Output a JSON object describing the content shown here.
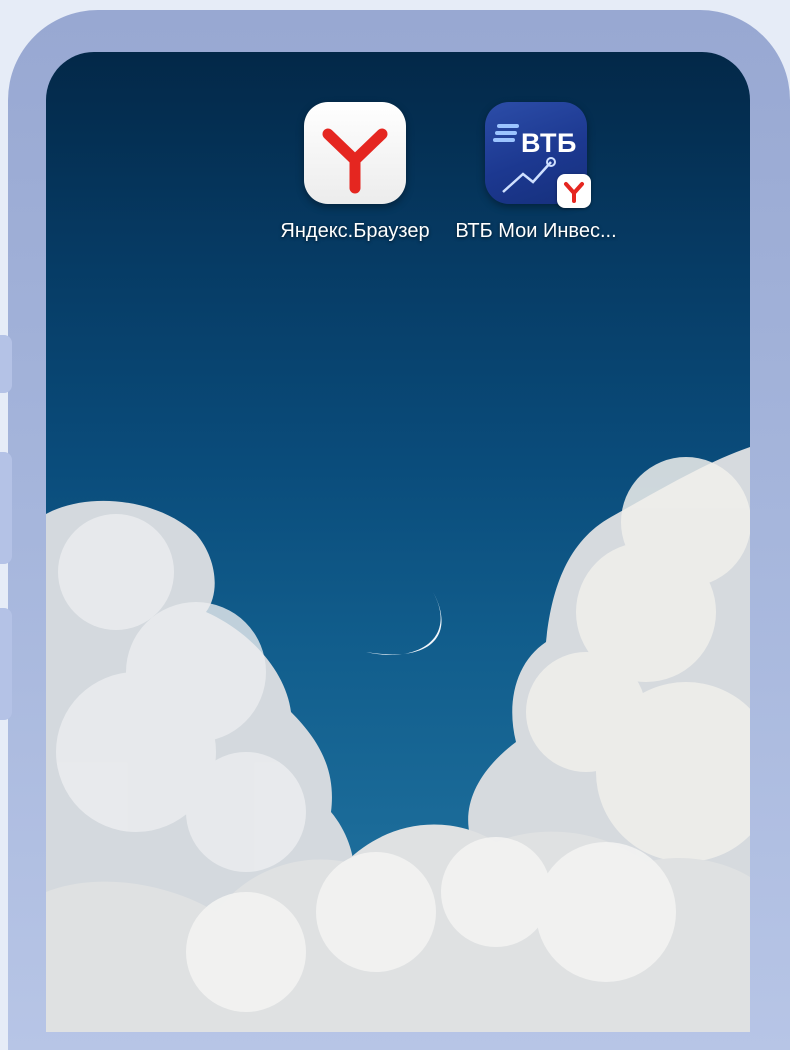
{
  "home_screen": {
    "apps": [
      {
        "label": "Яндекс.Браузер",
        "icon": "yandex-browser-icon"
      },
      {
        "label": "ВТБ Мои Инвес...",
        "icon": "vtb-investments-icon",
        "tile_text": "ВТБ",
        "badge_icon": "yandex-badge-icon"
      }
    ],
    "wallpaper": "night-sky-moon-clouds"
  },
  "colors": {
    "sky_top": "#032848",
    "sky_bottom": "#2b7aa6",
    "yandex_red": "#e52620",
    "vtb_blue": "#1c3890",
    "frame": "#a6b6dc"
  }
}
